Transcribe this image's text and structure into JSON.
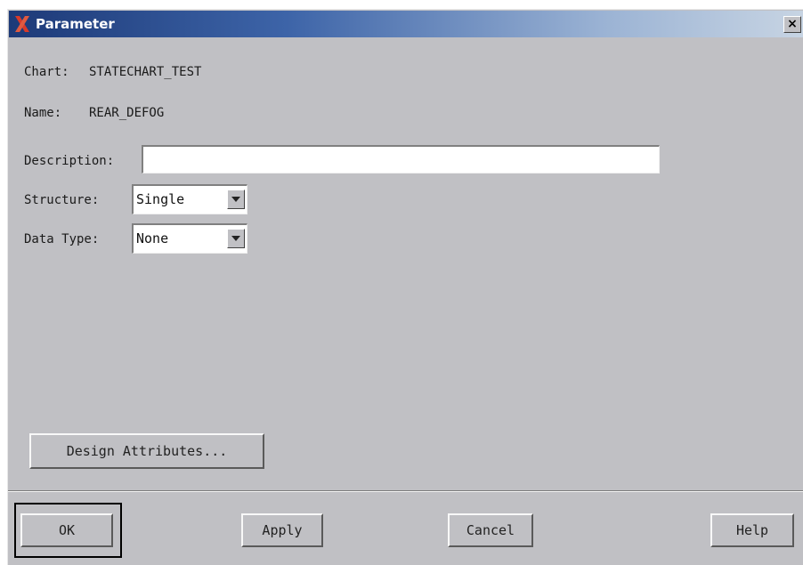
{
  "window": {
    "title": "Parameter",
    "close_glyph": "×",
    "app_icon": "x-logo-icon"
  },
  "info": {
    "chart_label": "Chart:",
    "chart_value": "STATECHART_TEST",
    "name_label": "Name:",
    "name_value": "REAR_DEFOG"
  },
  "form": {
    "description_label": "Description:",
    "description_value": "",
    "structure_label": "Structure:",
    "structure_value": "Single",
    "datatype_label": "Data Type:",
    "datatype_value": "None"
  },
  "buttons": {
    "design_attributes": "Design Attributes...",
    "ok": "OK",
    "apply": "Apply",
    "cancel": "Cancel",
    "help": "Help"
  },
  "colors": {
    "dialog_bg": "#c0c0c4",
    "title_gradient_start": "#1d3a78",
    "title_gradient_end": "#c7d4e3",
    "logo_red": "#d83a2a"
  }
}
